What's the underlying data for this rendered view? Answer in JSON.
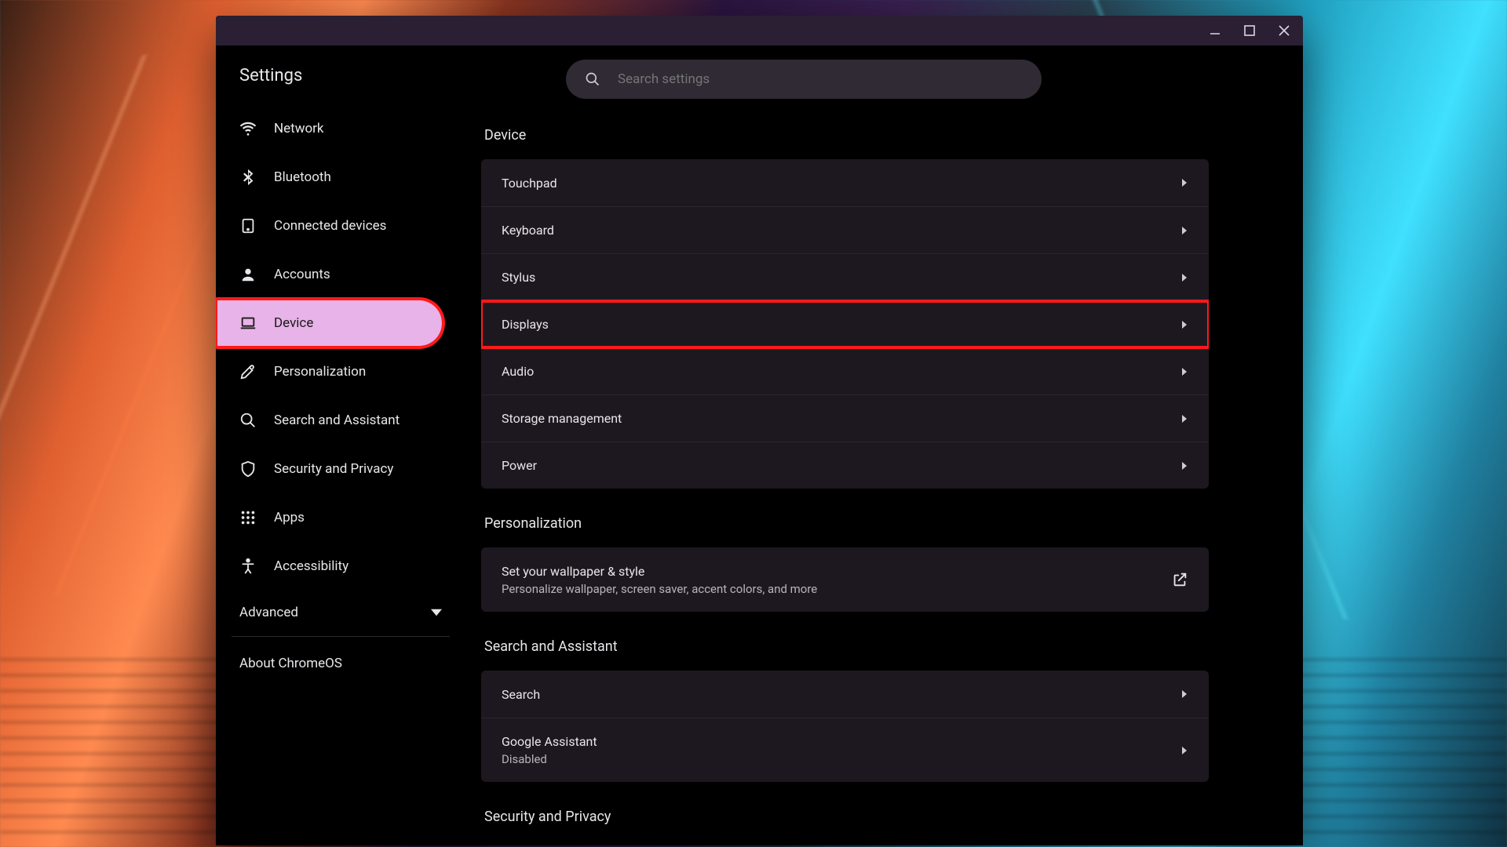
{
  "window": {
    "title": "Settings"
  },
  "search": {
    "placeholder": "Search settings"
  },
  "sidebar": {
    "items": [
      {
        "id": "network",
        "label": "Network",
        "icon": "wifi-icon"
      },
      {
        "id": "bluetooth",
        "label": "Bluetooth",
        "icon": "bluetooth-icon"
      },
      {
        "id": "connected",
        "label": "Connected devices",
        "icon": "device-icon"
      },
      {
        "id": "accounts",
        "label": "Accounts",
        "icon": "person-icon"
      },
      {
        "id": "device",
        "label": "Device",
        "icon": "laptop-icon",
        "selected": true,
        "redbox": true
      },
      {
        "id": "personalization",
        "label": "Personalization",
        "icon": "brush-icon"
      },
      {
        "id": "search",
        "label": "Search and Assistant",
        "icon": "search-icon"
      },
      {
        "id": "security",
        "label": "Security and Privacy",
        "icon": "shield-icon"
      },
      {
        "id": "apps",
        "label": "Apps",
        "icon": "apps-icon"
      },
      {
        "id": "accessibility",
        "label": "Accessibility",
        "icon": "accessibility-icon"
      }
    ],
    "advanced_label": "Advanced",
    "about_label": "About ChromeOS"
  },
  "sections": [
    {
      "title": "Device",
      "rows": [
        {
          "label": "Touchpad"
        },
        {
          "label": "Keyboard"
        },
        {
          "label": "Stylus"
        },
        {
          "label": "Displays",
          "redbox": true
        },
        {
          "label": "Audio"
        },
        {
          "label": "Storage management"
        },
        {
          "label": "Power"
        }
      ]
    },
    {
      "title": "Personalization",
      "rows": [
        {
          "label": "Set your wallpaper & style",
          "sub": "Personalize wallpaper, screen saver, accent colors, and more",
          "action": "open"
        }
      ]
    },
    {
      "title": "Search and Assistant",
      "rows": [
        {
          "label": "Search"
        },
        {
          "label": "Google Assistant",
          "sub": "Disabled"
        }
      ]
    },
    {
      "title": "Security and Privacy",
      "rows": []
    }
  ]
}
